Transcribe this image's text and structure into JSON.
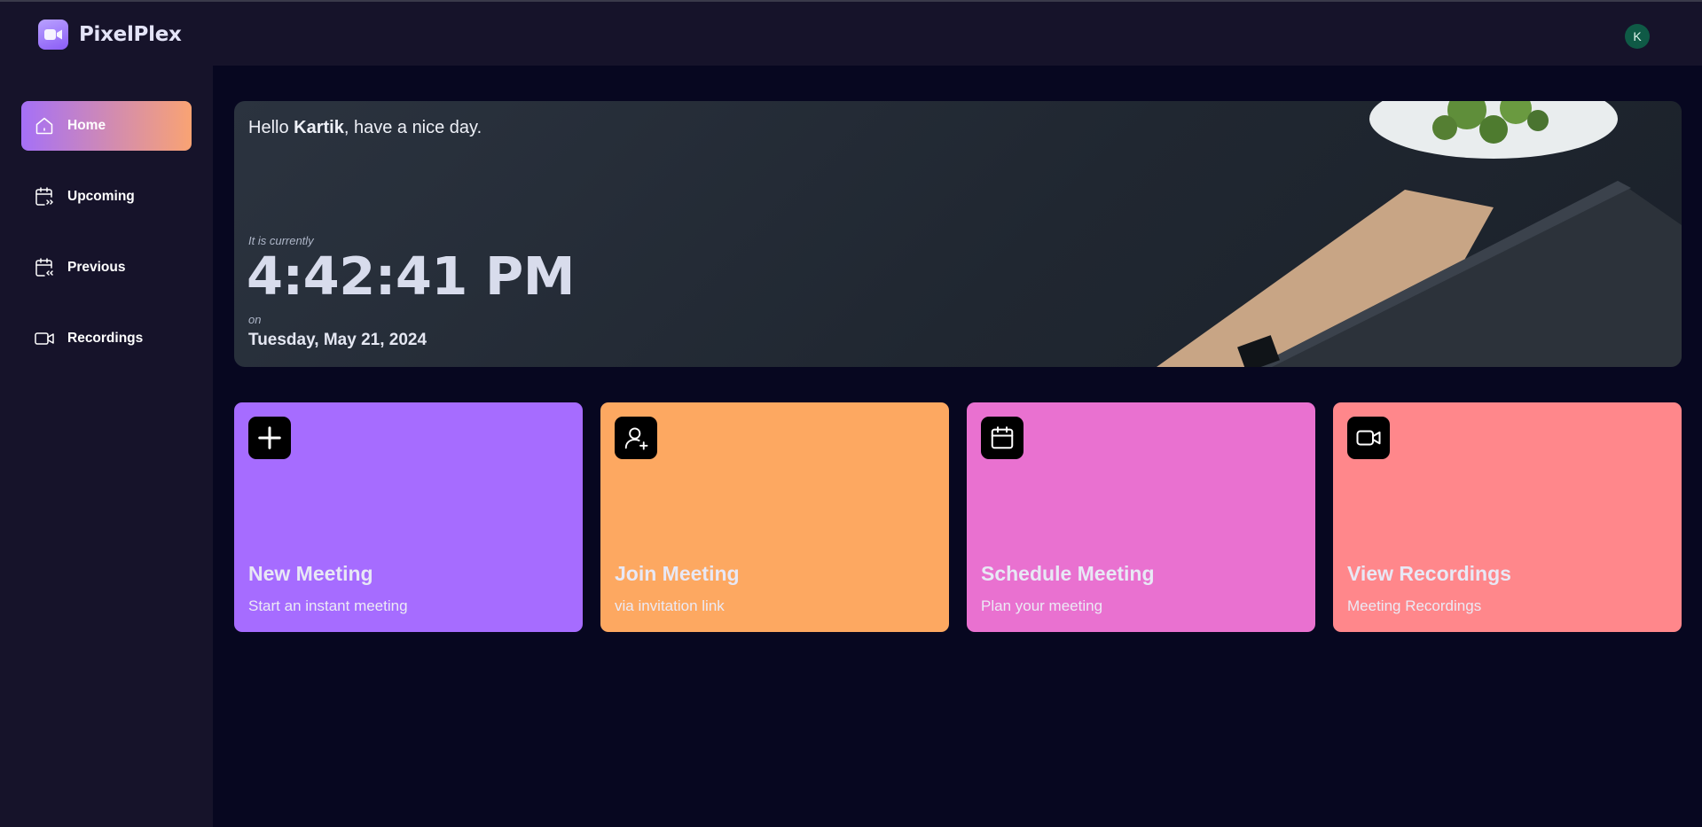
{
  "app": {
    "name": "PixelPlex",
    "logo_icon": "video-camera-icon"
  },
  "user": {
    "avatar_initial": "K"
  },
  "sidebar": {
    "items": [
      {
        "label": "Home",
        "icon": "home-icon",
        "active": true
      },
      {
        "label": "Upcoming",
        "icon": "calendar-upcoming-icon",
        "active": false
      },
      {
        "label": "Previous",
        "icon": "calendar-previous-icon",
        "active": false
      },
      {
        "label": "Recordings",
        "icon": "video-icon",
        "active": false
      }
    ]
  },
  "hero": {
    "greeting_prefix": "Hello ",
    "user_name": "Kartik",
    "greeting_suffix": ", have a nice day.",
    "time_label": "It is currently",
    "time": "4:42:41 PM",
    "date_label": "on",
    "date": "Tuesday, May 21, 2024"
  },
  "cards": [
    {
      "title": "New Meeting",
      "subtitle": "Start an instant meeting",
      "icon": "plus-icon",
      "color": "#a66cff"
    },
    {
      "title": "Join Meeting",
      "subtitle": "via invitation link",
      "icon": "user-plus-icon",
      "color": "#fda861"
    },
    {
      "title": "Schedule Meeting",
      "subtitle": "Plan your meeting",
      "icon": "calendar-icon",
      "color": "#e971d0"
    },
    {
      "title": "View Recordings",
      "subtitle": "Meeting Recordings",
      "icon": "video-icon",
      "color": "#ff878b"
    }
  ],
  "colors": {
    "background": "#070720",
    "panel": "#16132a",
    "active_gradient_start": "#a570f7",
    "active_gradient_end": "#f9a373"
  }
}
